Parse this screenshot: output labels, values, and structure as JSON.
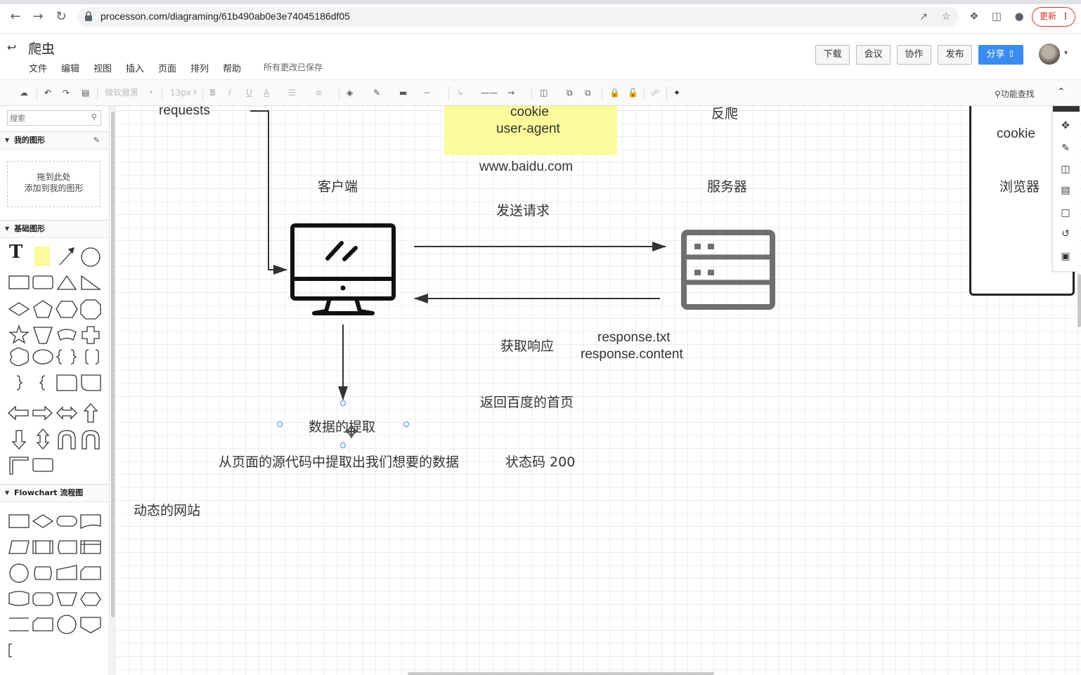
{
  "browser": {
    "url": "processon.com/diagraming/61b490ab0e3e74045186df05",
    "update_label": "更新"
  },
  "app": {
    "title": "爬虫",
    "menu": [
      "文件",
      "编辑",
      "视图",
      "插入",
      "页面",
      "排列",
      "帮助"
    ],
    "save_status": "所有更改已保存",
    "buttons": {
      "download": "下载",
      "meeting": "会议",
      "collab": "协作",
      "publish": "发布",
      "share": "分享"
    }
  },
  "toolbar": {
    "font_family": "微软雅黑",
    "font_size": "13px",
    "feature_search": "功能查找"
  },
  "sidebar": {
    "search_placeholder": "搜索",
    "my_shapes": "我的图形",
    "drop_zone_line1": "拖到此处",
    "drop_zone_line2": "添加到我的图形",
    "basic_shapes": "基础图形",
    "flowchart": "Flowchart 流程图"
  },
  "canvas": {
    "requests": "requests",
    "cookie_note_line1": "cookie",
    "cookie_note_line2": "user-agent",
    "anti_crawl": "反爬",
    "cookie_right": "cookie",
    "browser_label": "浏览器",
    "url_label": "www.baidu.com",
    "client_label": "客户端",
    "server_label": "服务器",
    "send_request": "发送请求",
    "get_response": "获取响应",
    "response_txt": "response.txt",
    "response_content": "response.content",
    "return_home": "返回百度的首页",
    "data_extract": "数据的提取",
    "extract_desc": "从页面的源代码中提取出我们想要的数据",
    "status_code": "状态码 200",
    "dynamic_site": "动态的网站"
  },
  "colors": {
    "accent": "#3b8cf0",
    "sticky": "#fbfb9c",
    "update_red": "#d93025",
    "server_gray": "#6f6f6f"
  }
}
